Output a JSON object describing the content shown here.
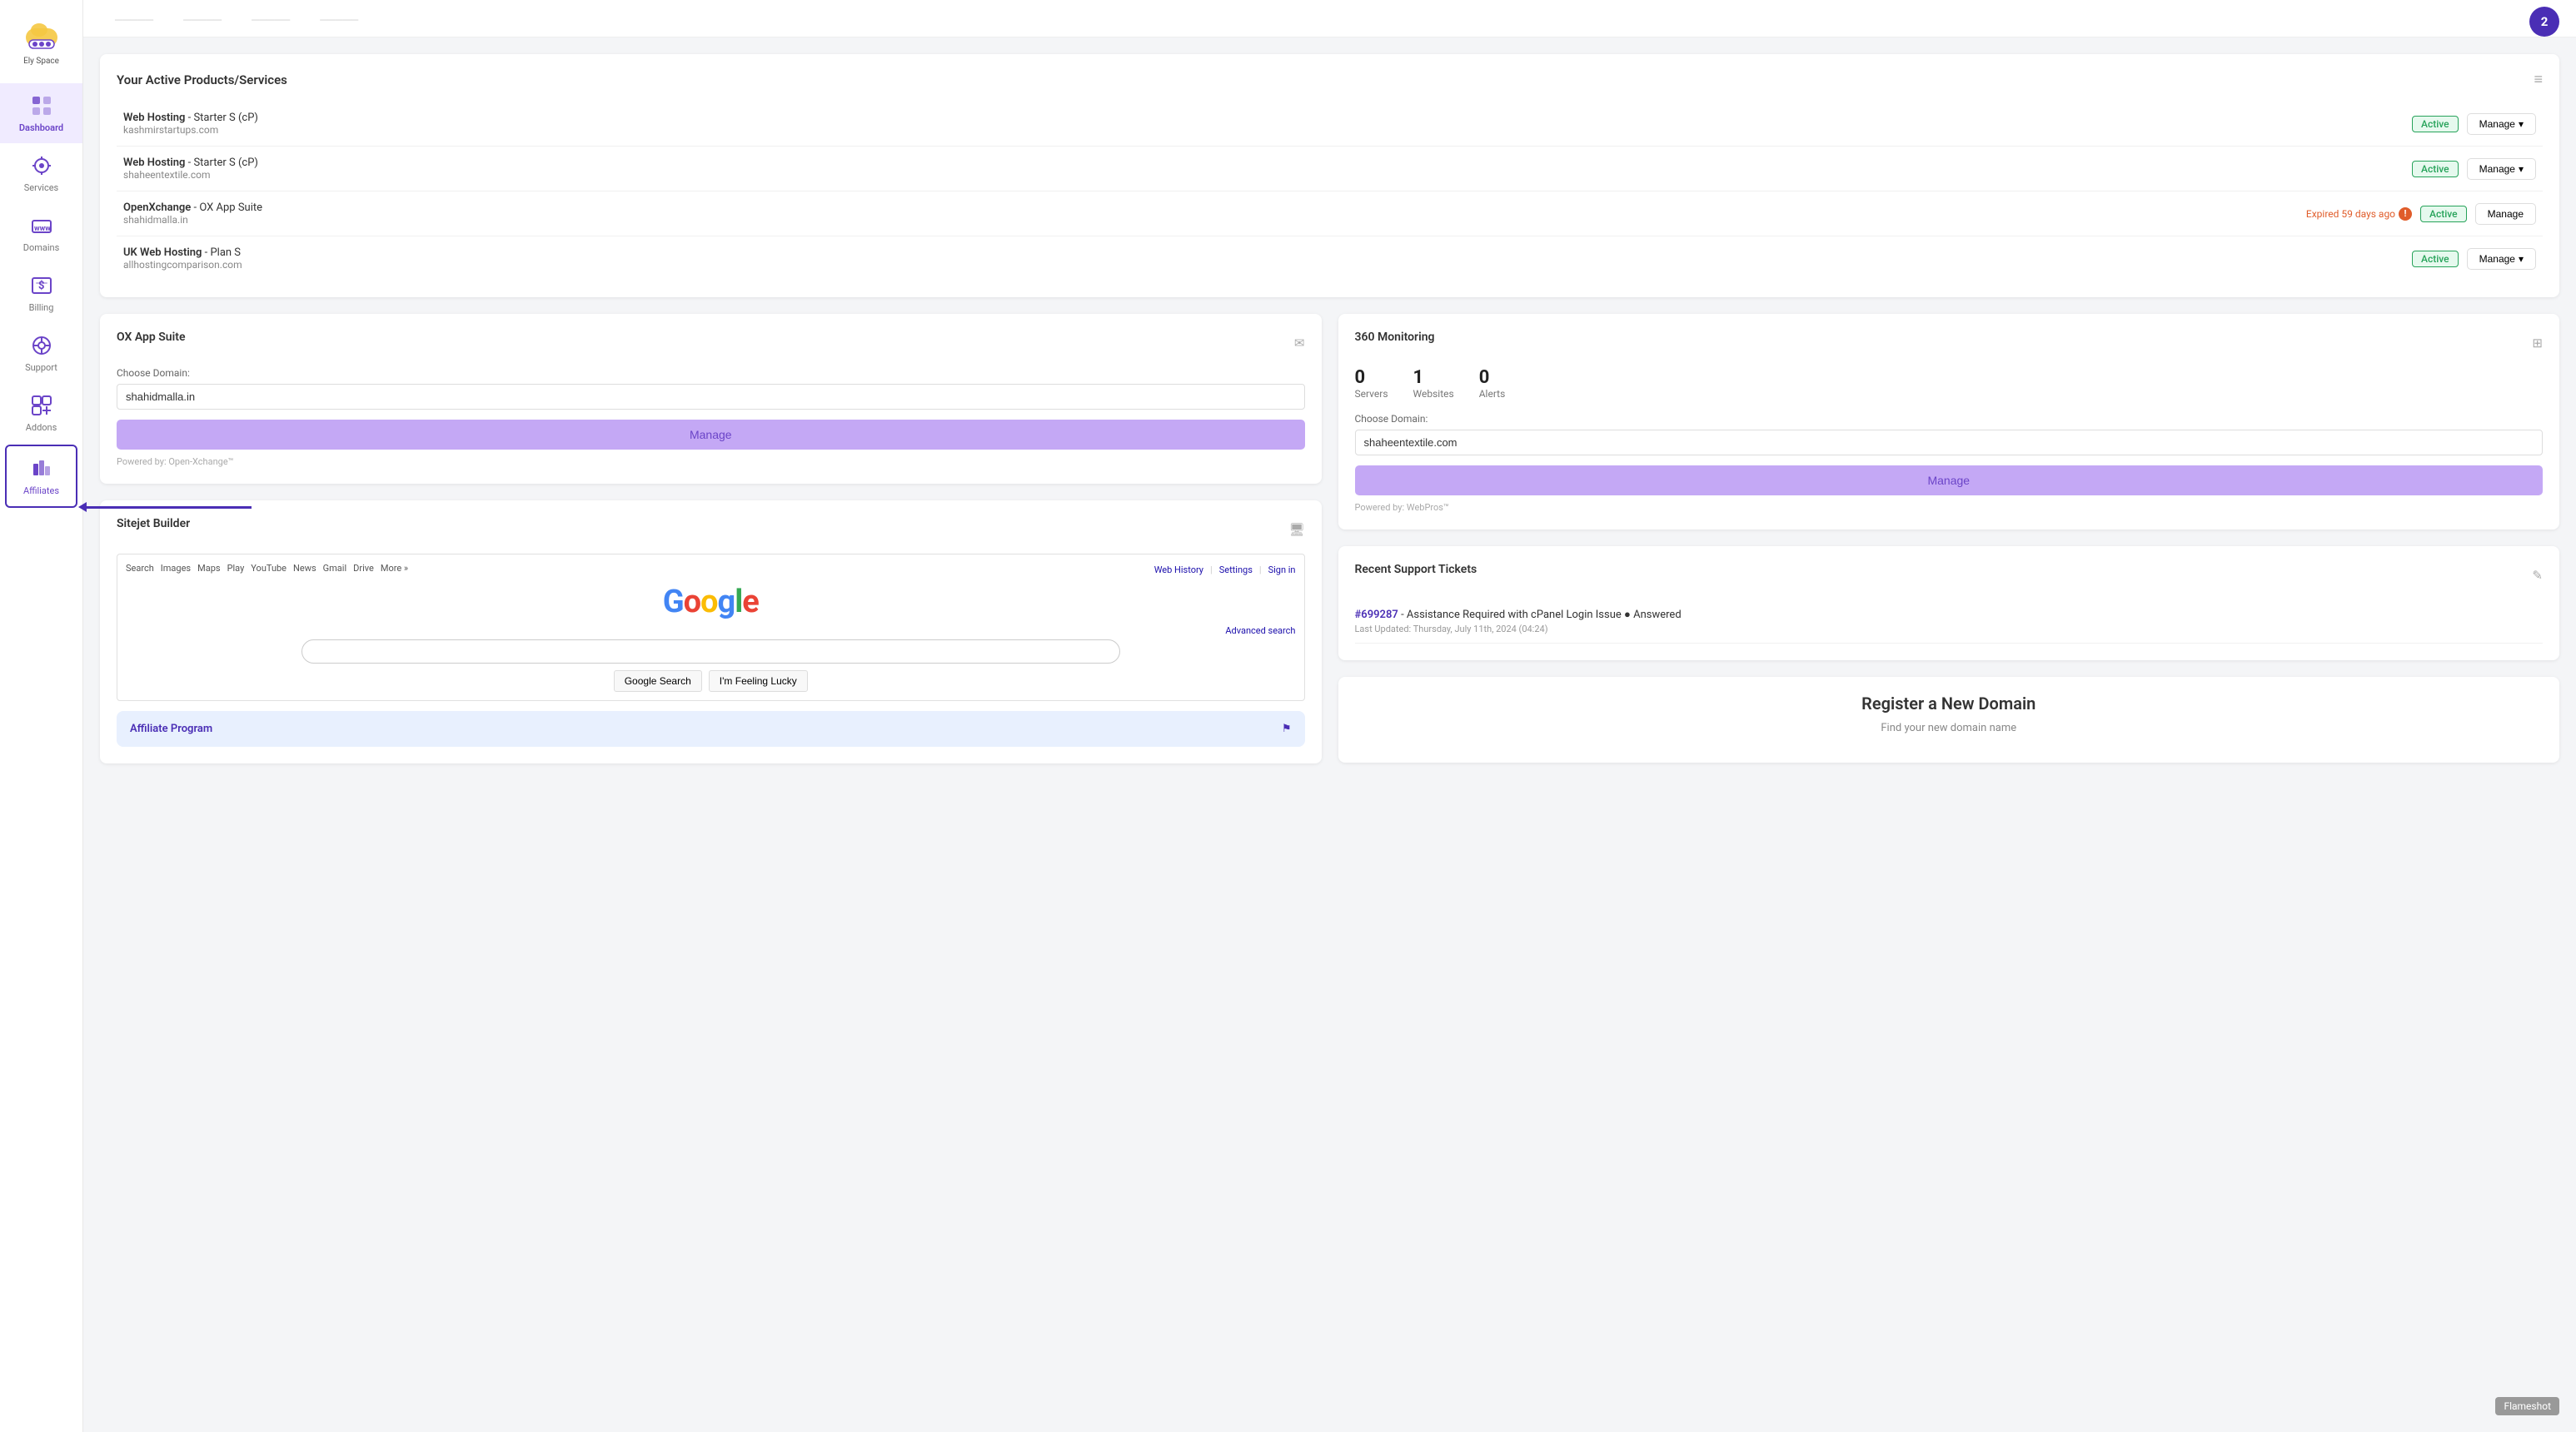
{
  "logo": {
    "name": "Ely Space",
    "badge": "2"
  },
  "sidebar": {
    "items": [
      {
        "id": "dashboard",
        "label": "Dashboard",
        "active": true,
        "icon": "dashboard"
      },
      {
        "id": "services",
        "label": "Services",
        "icon": "services"
      },
      {
        "id": "domains",
        "label": "Domains",
        "icon": "domains"
      },
      {
        "id": "billing",
        "label": "Billing",
        "icon": "billing"
      },
      {
        "id": "support",
        "label": "Support",
        "icon": "support"
      },
      {
        "id": "addons",
        "label": "Addons",
        "icon": "addons"
      },
      {
        "id": "affiliates",
        "label": "Affiliates",
        "selected": true,
        "icon": "affiliates"
      }
    ]
  },
  "products_section": {
    "title": "Your Active Products/Services",
    "items": [
      {
        "name": "Web Hosting",
        "plan": "Starter S (cP)",
        "domain": "kashmirstartups.com",
        "status": "Active",
        "expired": null
      },
      {
        "name": "Web Hosting",
        "plan": "Starter S (cP)",
        "domain": "shaheentextile.com",
        "status": "Active",
        "expired": null
      },
      {
        "name": "OpenXchange",
        "plan": "OX App Suite",
        "domain": "shahidmalla.in",
        "status": "Active",
        "expired": "Expired 59 days ago"
      },
      {
        "name": "UK Web Hosting",
        "plan": "Plan S",
        "domain": "allhostingcomparison.com",
        "status": "Active",
        "expired": null
      }
    ],
    "manage_label": "Manage"
  },
  "ox_app_suite": {
    "title": "OX App Suite",
    "choose_domain_label": "Choose Domain:",
    "selected_domain": "shahidmalla.in",
    "manage_label": "Manage",
    "powered_by": "Powered by: Open-Xchange™"
  },
  "sitejet": {
    "title": "Sitejet Builder",
    "search_links": [
      "Search",
      "Images",
      "Maps",
      "Play",
      "YouTube",
      "News",
      "Gmail",
      "Drive",
      "More »"
    ],
    "web_links": [
      "Web History",
      "Settings",
      "Sign in"
    ],
    "google_logo": "Google",
    "advanced_search": "Advanced search",
    "search_placeholder": "",
    "google_search_btn": "Google Search",
    "lucky_btn": "I'm Feeling Lucky"
  },
  "affiliate_program": {
    "title": "Affiliate Program",
    "icon": "flag"
  },
  "monitoring": {
    "title": "360 Monitoring",
    "servers": {
      "value": "0",
      "label": "Servers"
    },
    "websites": {
      "value": "1",
      "label": "Websites"
    },
    "alerts": {
      "value": "0",
      "label": "Alerts"
    },
    "choose_domain_label": "Choose Domain:",
    "selected_domain": "shaheentextile.com",
    "manage_label": "Manage",
    "powered_by": "Powered by: WebPros™"
  },
  "support": {
    "title": "Recent Support Tickets",
    "tickets": [
      {
        "id": "#699287",
        "description": "Assistance Required with cPanel Login Issue",
        "status": "Answered",
        "updated": "Last Updated: Thursday, July 11th, 2024 (04:24)"
      }
    ]
  },
  "register_domain": {
    "title": "Register a New Domain",
    "subtitle": "Find your new domain name"
  },
  "flameshot": "Flameshot"
}
